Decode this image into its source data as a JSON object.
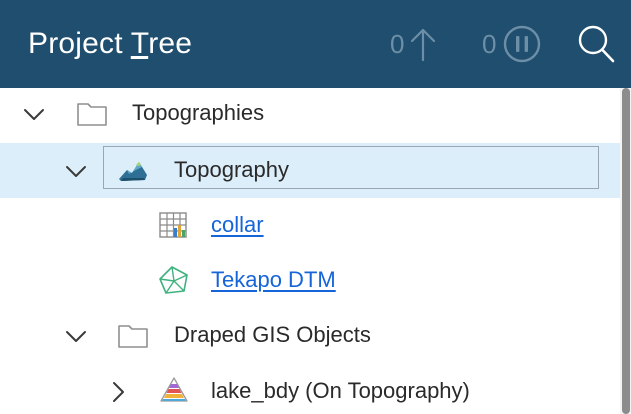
{
  "header": {
    "title_prefix": "Project ",
    "title_accel": "T",
    "title_rest": "ree",
    "upload_count": "0",
    "pause_count": "0"
  },
  "tree": {
    "items": [
      {
        "label": "Topographies",
        "icon": "folder-icon",
        "expanded": true
      },
      {
        "label": "Topography",
        "icon": "topography-surface-icon",
        "expanded": true,
        "selected": true
      },
      {
        "label": "collar",
        "icon": "table-grid-icon",
        "link": true
      },
      {
        "label": "Tekapo DTM",
        "icon": "mesh-icon",
        "link": true
      },
      {
        "label": "Draped GIS Objects",
        "icon": "folder-icon",
        "expanded": true
      },
      {
        "label": "lake_bdy (On Topography)",
        "icon": "draped-gis-icon",
        "expanded": false
      }
    ]
  },
  "colors": {
    "header_bg": "#1f4e6e",
    "selection_bg": "#dceef9",
    "link": "#1565d8"
  }
}
